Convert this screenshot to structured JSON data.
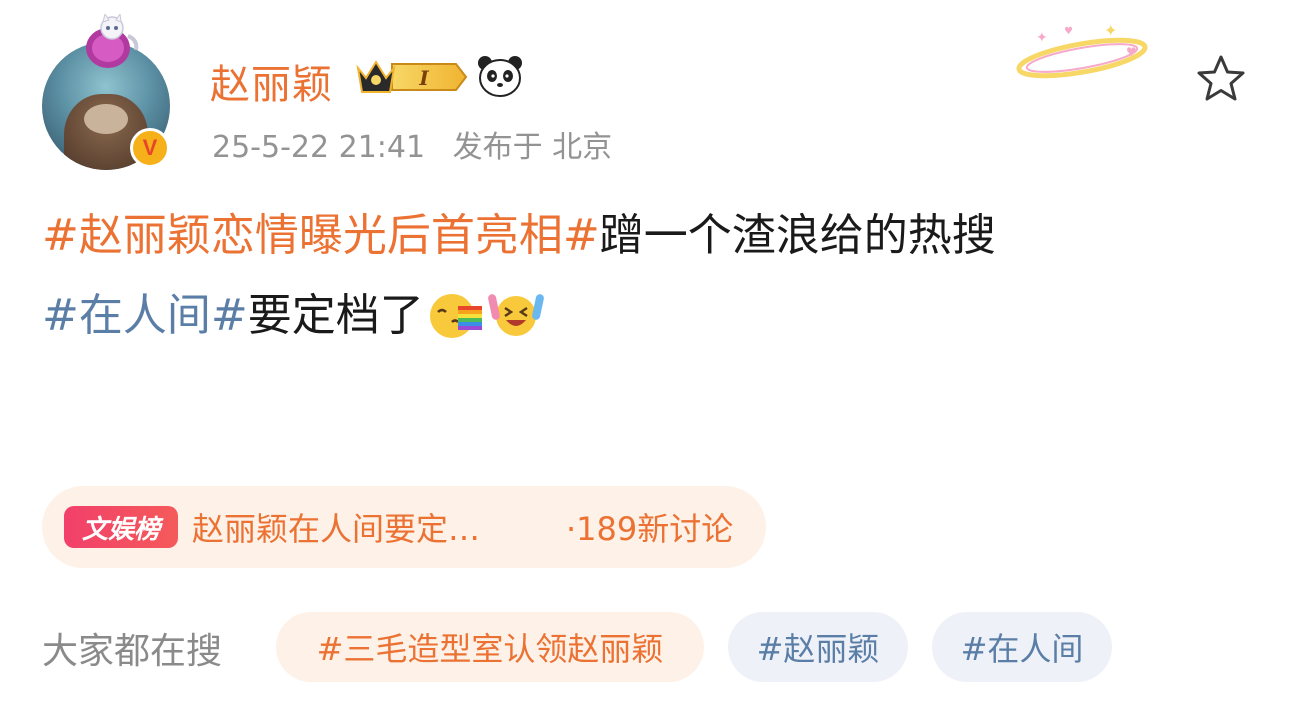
{
  "user": {
    "name": "赵丽颖",
    "vip_level": "I",
    "verified_mark": "V"
  },
  "meta": {
    "datetime": "25-5-22 21:41",
    "location": "发布于 北京"
  },
  "post": {
    "topic1": "#赵丽颖恋情曝光后首亮相#",
    "text1": "蹭一个渣浪给的热搜",
    "topic2": "#在人间#",
    "text2": "要定档了"
  },
  "hot_list": {
    "tag": "文娱榜",
    "title": "赵丽颖在人间要定…",
    "count": "·189新讨论"
  },
  "search": {
    "label": "大家都在搜",
    "chips": [
      "#三毛造型室认领赵丽颖",
      "#赵丽颖",
      "#在人间"
    ]
  },
  "colors": {
    "accent": "#eb7233",
    "topic_blue": "#5b7ea7",
    "meta_gray": "#939393"
  },
  "icons": [
    "star-icon",
    "panda-icon",
    "vip-crown-icon",
    "verified-icon",
    "emoji-rainbow-icon",
    "emoji-laugh-icon"
  ]
}
